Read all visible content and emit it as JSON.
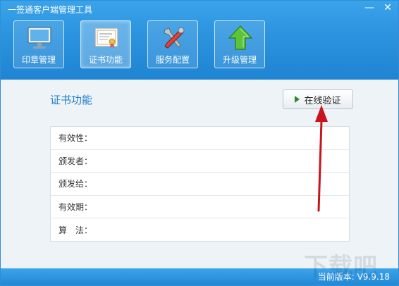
{
  "app": {
    "title": "一签通客户端管理工具"
  },
  "window_controls": {
    "minimize": "—",
    "close": "✕"
  },
  "toolbar": {
    "items": [
      {
        "label": "印章管理",
        "icon": "monitor-icon"
      },
      {
        "label": "证书功能",
        "icon": "certificate-icon"
      },
      {
        "label": "服务配置",
        "icon": "tools-icon"
      },
      {
        "label": "升级管理",
        "icon": "upgrade-arrow-icon"
      }
    ],
    "active_index": 1
  },
  "main": {
    "section_title": "证书功能",
    "verify_button_label": "在线验证",
    "fields": [
      {
        "label": "有效性：",
        "value": ""
      },
      {
        "label": "颁发者：",
        "value": ""
      },
      {
        "label": "颁发给：",
        "value": ""
      },
      {
        "label": "有效期：",
        "value": ""
      },
      {
        "label": "算　法：",
        "value": ""
      }
    ]
  },
  "statusbar": {
    "version": "当前版本: V9.9.18"
  },
  "watermark": "下载吧",
  "colors": {
    "header": "#2b93de",
    "accent_text": "#1f7fc9",
    "annotation_arrow": "#c8141e"
  }
}
